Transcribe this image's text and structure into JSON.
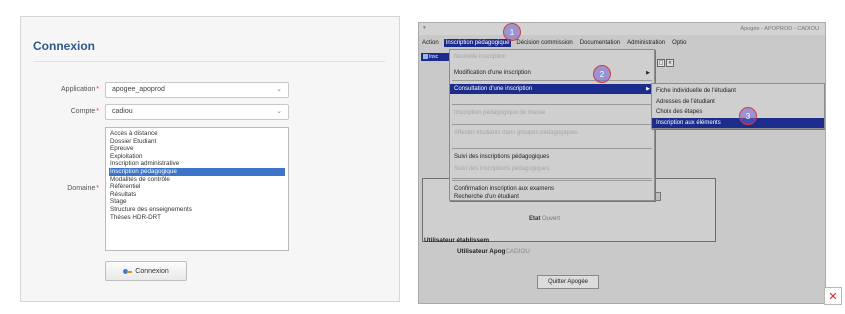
{
  "login": {
    "title": "Connexion",
    "application_label": "Application",
    "application_value": "apogee_apoprod",
    "compte_label": "Compte",
    "compte_value": "cadiou",
    "domaine_label": "Domaine",
    "required_marker": "*",
    "domaines": [
      "Accès à distance",
      "Dossier Etudiant",
      "Epreuve",
      "Exploitation",
      "Inscription administrative",
      "Inscription pédagogique",
      "Modalités de contrôle",
      "Référentiel",
      "Résultats",
      "Stage",
      "Structure des enseignements",
      "Thèses HDR-DRT"
    ],
    "selected_domaine_index": 5,
    "connect_label": "Connexion"
  },
  "apogee": {
    "title": "Apogée - APOPROD - CADIOU",
    "menu": [
      "Action",
      "Inscription pédagogique",
      "Décision commission",
      "Documentation",
      "Administration",
      "Optio"
    ],
    "active_menu_index": 1,
    "inner_window_label": "Insc",
    "dropdown_items": [
      {
        "label": "Nouvelle inscription",
        "disabled": true
      },
      {
        "label": "Modification d'une inscription",
        "disabled": false,
        "submenu": true
      },
      {
        "label": "Consultation d'une inscription",
        "disabled": false,
        "submenu": true,
        "highlighted": true
      },
      {
        "label": "Inscription pédagogique de masse",
        "disabled": true
      },
      {
        "label": "Affecter étudiants dans groupes pédagogiques",
        "disabled": true
      },
      {
        "label": "Suivi des inscriptions pédagogiques",
        "disabled": false
      },
      {
        "label": "Suivi des inscriptions pédagogiques",
        "disabled": true
      },
      {
        "label": "Confirmation inscription aux examens",
        "disabled": false
      },
      {
        "label": "Recherche d'un étudiant",
        "disabled": false
      }
    ],
    "submenu_items": [
      {
        "label": "Fiche individuelle de l'étudiant",
        "highlighted": false
      },
      {
        "label": "Adresses de l'étudiant",
        "highlighted": false
      },
      {
        "label": "Choix des étapes",
        "highlighted": false
      },
      {
        "label": "Inscription aux éléments",
        "highlighted": true
      }
    ],
    "etat_label": "Etat",
    "etat_value": "Ouvert",
    "utilisateur_etab_label": "Utilisateur établissem",
    "utilisateur_apogee_label": "Utilisateur Apog",
    "utilisateur_apogee_value": "CADIOU",
    "quit_label": "Quitter Apogée",
    "steps": [
      "1",
      "2",
      "3"
    ],
    "accent": "#1c2c8c"
  },
  "close_icon": "close-icon"
}
